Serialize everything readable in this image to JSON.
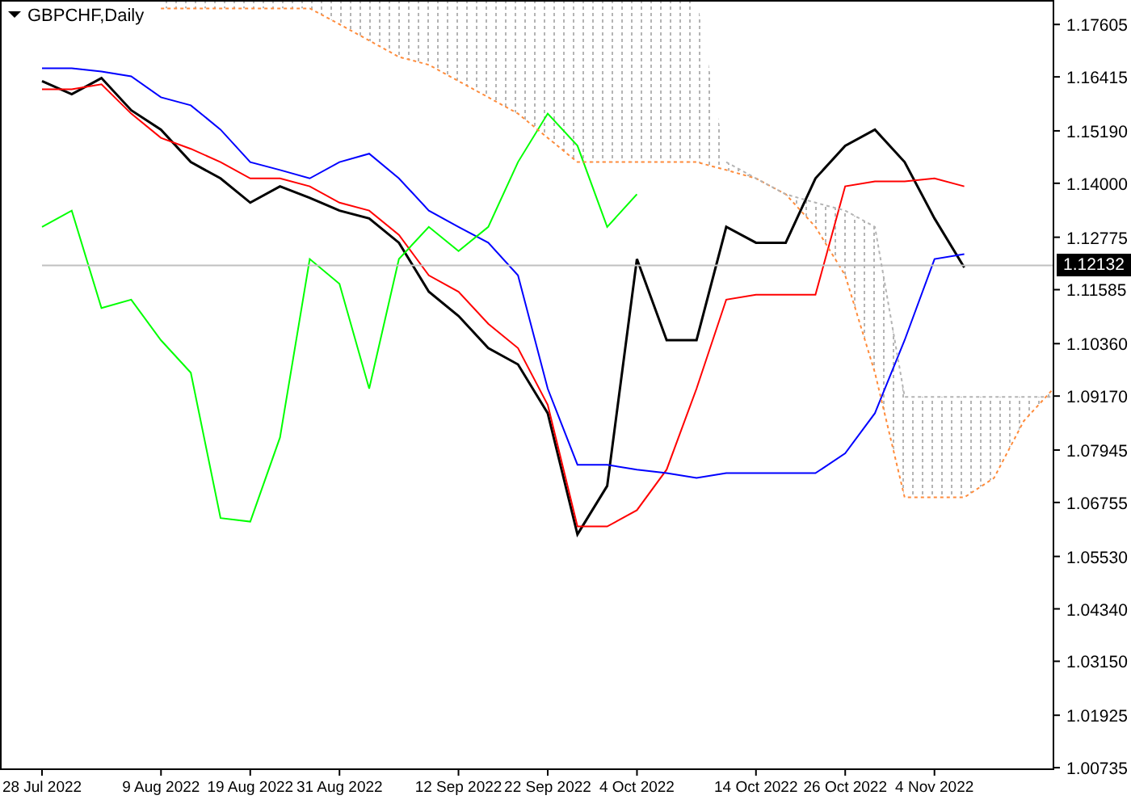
{
  "chart": {
    "title": "GBPCHF,Daily",
    "price_tag": "1.12132",
    "chart_data": {
      "type": "line",
      "ylim": [
        1.007,
        1.1816
      ],
      "categories": [
        "28 Jul 2022",
        null,
        null,
        null,
        "9 Aug 2022",
        null,
        null,
        "19 Aug 2022",
        null,
        null,
        "31 Aug 2022",
        null,
        null,
        null,
        "12 Sep 2022",
        null,
        null,
        "22 Sep 2022",
        null,
        null,
        "4 Oct 2022",
        null,
        null,
        null,
        "14 Oct 2022",
        null,
        null,
        "26 Oct 2022",
        null,
        null,
        "4 Nov 2022",
        null,
        null,
        null,
        null
      ],
      "series": [
        {
          "color": "#000000",
          "values": [
            1.1632,
            1.1602,
            1.1639,
            1.1566,
            1.1522,
            1.1448,
            1.1411,
            1.1356,
            1.1393,
            1.1367,
            1.1338,
            1.132,
            1.1265,
            1.1154,
            1.1099,
            1.1026,
            1.0989,
            1.0878,
            1.0603,
            1.0713,
            1.1228,
            1.1044,
            1.1044,
            1.1301,
            1.1265,
            1.1265,
            1.1411,
            1.1485,
            1.1522,
            1.1448,
            1.132,
            1.1209,
            null,
            null,
            null
          ]
        },
        {
          "color": "#ff0000",
          "values": [
            1.1613,
            1.1613,
            1.1625,
            1.1558,
            1.1503,
            1.1478,
            1.1448,
            1.1411,
            1.1411,
            1.1393,
            1.1356,
            1.1338,
            1.1283,
            1.1191,
            1.1154,
            1.1081,
            1.1026,
            1.0897,
            1.0621,
            1.0621,
            1.0658,
            1.075,
            1.0934,
            1.1136,
            1.1147,
            1.1147,
            1.1147,
            1.1393,
            1.1404,
            1.1404,
            1.1411,
            1.1393,
            null,
            null,
            null
          ]
        },
        {
          "color": "#0000ff",
          "values": [
            1.1661,
            1.1661,
            1.1654,
            1.1643,
            1.1595,
            1.1577,
            1.1522,
            1.1448,
            1.143,
            1.1411,
            1.1448,
            1.1467,
            1.1411,
            1.1338,
            1.1301,
            1.1265,
            1.1191,
            1.0934,
            1.0761,
            1.0761,
            1.075,
            1.0742,
            1.0731,
            1.0742,
            1.0742,
            1.0742,
            1.0742,
            1.0787,
            1.0878,
            1.1044,
            1.1228,
            1.1239,
            null,
            null,
            null
          ]
        },
        {
          "color": "#00ff00",
          "values": [
            1.1301,
            1.1338,
            1.1117,
            1.1136,
            1.1044,
            1.097,
            1.064,
            1.0632,
            1.0823,
            1.1228,
            1.1172,
            1.0934,
            1.1228,
            1.1301,
            1.1246,
            1.1301,
            1.1448,
            1.1558,
            1.1485,
            1.1301,
            1.1375,
            null,
            null,
            null,
            null,
            null,
            null,
            null,
            null,
            null,
            null,
            null,
            null,
            null,
            null
          ]
        },
        {
          "color": "#ff8c3c",
          "line_style": "dashed",
          "values": [
            null,
            null,
            null,
            null,
            1.1797,
            1.1797,
            1.1797,
            1.1797,
            1.1797,
            1.1797,
            1.1761,
            1.1724,
            1.1687,
            1.1669,
            1.1632,
            1.1595,
            1.1558,
            1.1503,
            1.1448,
            1.1448,
            1.1448,
            1.1448,
            1.1448,
            1.143,
            1.1411,
            1.1375,
            1.1301,
            1.1191,
            1.097,
            1.0687,
            1.0687,
            1.0687,
            1.0731,
            1.086,
            1.0934
          ]
        },
        {
          "color": "#c0c0c0",
          "values": [
            1.12132,
            1.12132,
            1.12132,
            1.12132,
            1.12132,
            1.12132,
            1.12132,
            1.12132,
            1.12132,
            1.12132,
            1.12132,
            1.12132,
            1.12132,
            1.12132,
            1.12132,
            1.12132,
            1.12132,
            1.12132,
            1.12132,
            1.12132,
            1.12132,
            1.12132,
            1.12132,
            1.12132,
            1.12132,
            1.12132,
            1.12132,
            1.12132,
            1.12132,
            1.12132,
            1.12132,
            1.12132,
            1.12132,
            1.12132,
            1.12132
          ]
        },
        {
          "color": "#b4b4b4",
          "line_style": "dashed",
          "values": [
            null,
            null,
            null,
            null,
            null,
            null,
            null,
            null,
            null,
            null,
            null,
            null,
            null,
            null,
            null,
            null,
            null,
            null,
            null,
            null,
            null,
            null,
            null,
            1.1448,
            1.1411,
            1.1375,
            1.1356,
            1.1338,
            1.1301,
            1.0915,
            1.0915,
            1.0915,
            1.0915,
            1.0915,
            1.0915
          ]
        }
      ],
      "yticks": [
        {
          "value": 1.17605,
          "label": "1.17605"
        },
        {
          "value": 1.16415,
          "label": "1.16415"
        },
        {
          "value": 1.1519,
          "label": "1.15190"
        },
        {
          "value": 1.14,
          "label": "1.14000"
        },
        {
          "value": 1.12775,
          "label": "1.12775"
        },
        {
          "value": 1.11585,
          "label": "1.11585"
        },
        {
          "value": 1.1036,
          "label": "1.10360"
        },
        {
          "value": 1.0917,
          "label": "1.09170"
        },
        {
          "value": 1.07945,
          "label": "1.07945"
        },
        {
          "value": 1.06755,
          "label": "1.06755"
        },
        {
          "value": 1.0553,
          "label": "1.05530"
        },
        {
          "value": 1.0434,
          "label": "1.04340"
        },
        {
          "value": 1.0315,
          "label": "1.03150"
        },
        {
          "value": 1.01925,
          "label": "1.01925"
        },
        {
          "value": 1.00735,
          "label": "1.00735"
        }
      ]
    }
  }
}
